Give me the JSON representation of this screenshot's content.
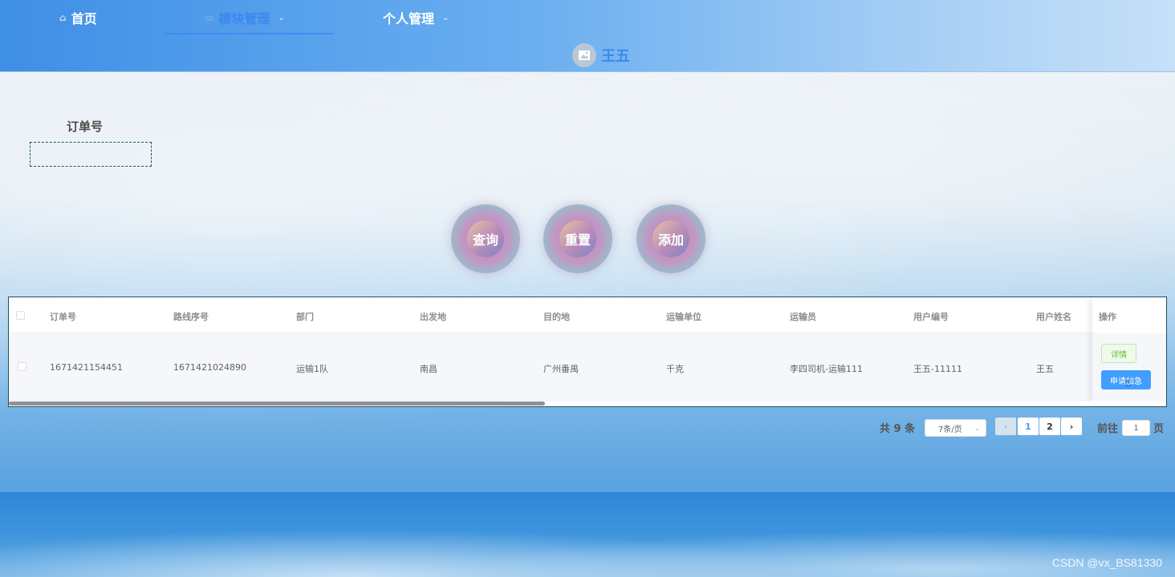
{
  "nav": {
    "home_label": "首页",
    "module_label": "模块管理",
    "personal_label": "个人管理",
    "user_name": "王五"
  },
  "search": {
    "label": "订单号",
    "value": ""
  },
  "buttons": {
    "query": "查询",
    "reset": "重置",
    "add": "添加"
  },
  "table": {
    "columns": [
      "订单号",
      "路线序号",
      "部门",
      "出发地",
      "目的地",
      "运输单位",
      "运输员",
      "用户编号",
      "用户姓名",
      "操作"
    ],
    "rows": [
      {
        "order_no": "1671421154451",
        "route_no": "1671421024890",
        "department": "运输1队",
        "origin": "南昌",
        "destination": "广州番禺",
        "transport_unit": "千克",
        "transporter": "李四司机-运输111",
        "user_id": "王五-11111",
        "user_name": "王五"
      }
    ],
    "actions": {
      "detail": "详情",
      "apply": "申请加急"
    }
  },
  "pagination": {
    "total": "共 9 条",
    "page_size": "7条/页",
    "pages": [
      "1",
      "2"
    ],
    "current": "1",
    "goto_label": "前往",
    "goto_value": "1",
    "page_suffix": "页"
  },
  "watermark": "CSDN @vx_BS81330",
  "colors": {
    "accent": "#409eff",
    "nav_active": "#3a88f0",
    "success": "#67c23a"
  }
}
